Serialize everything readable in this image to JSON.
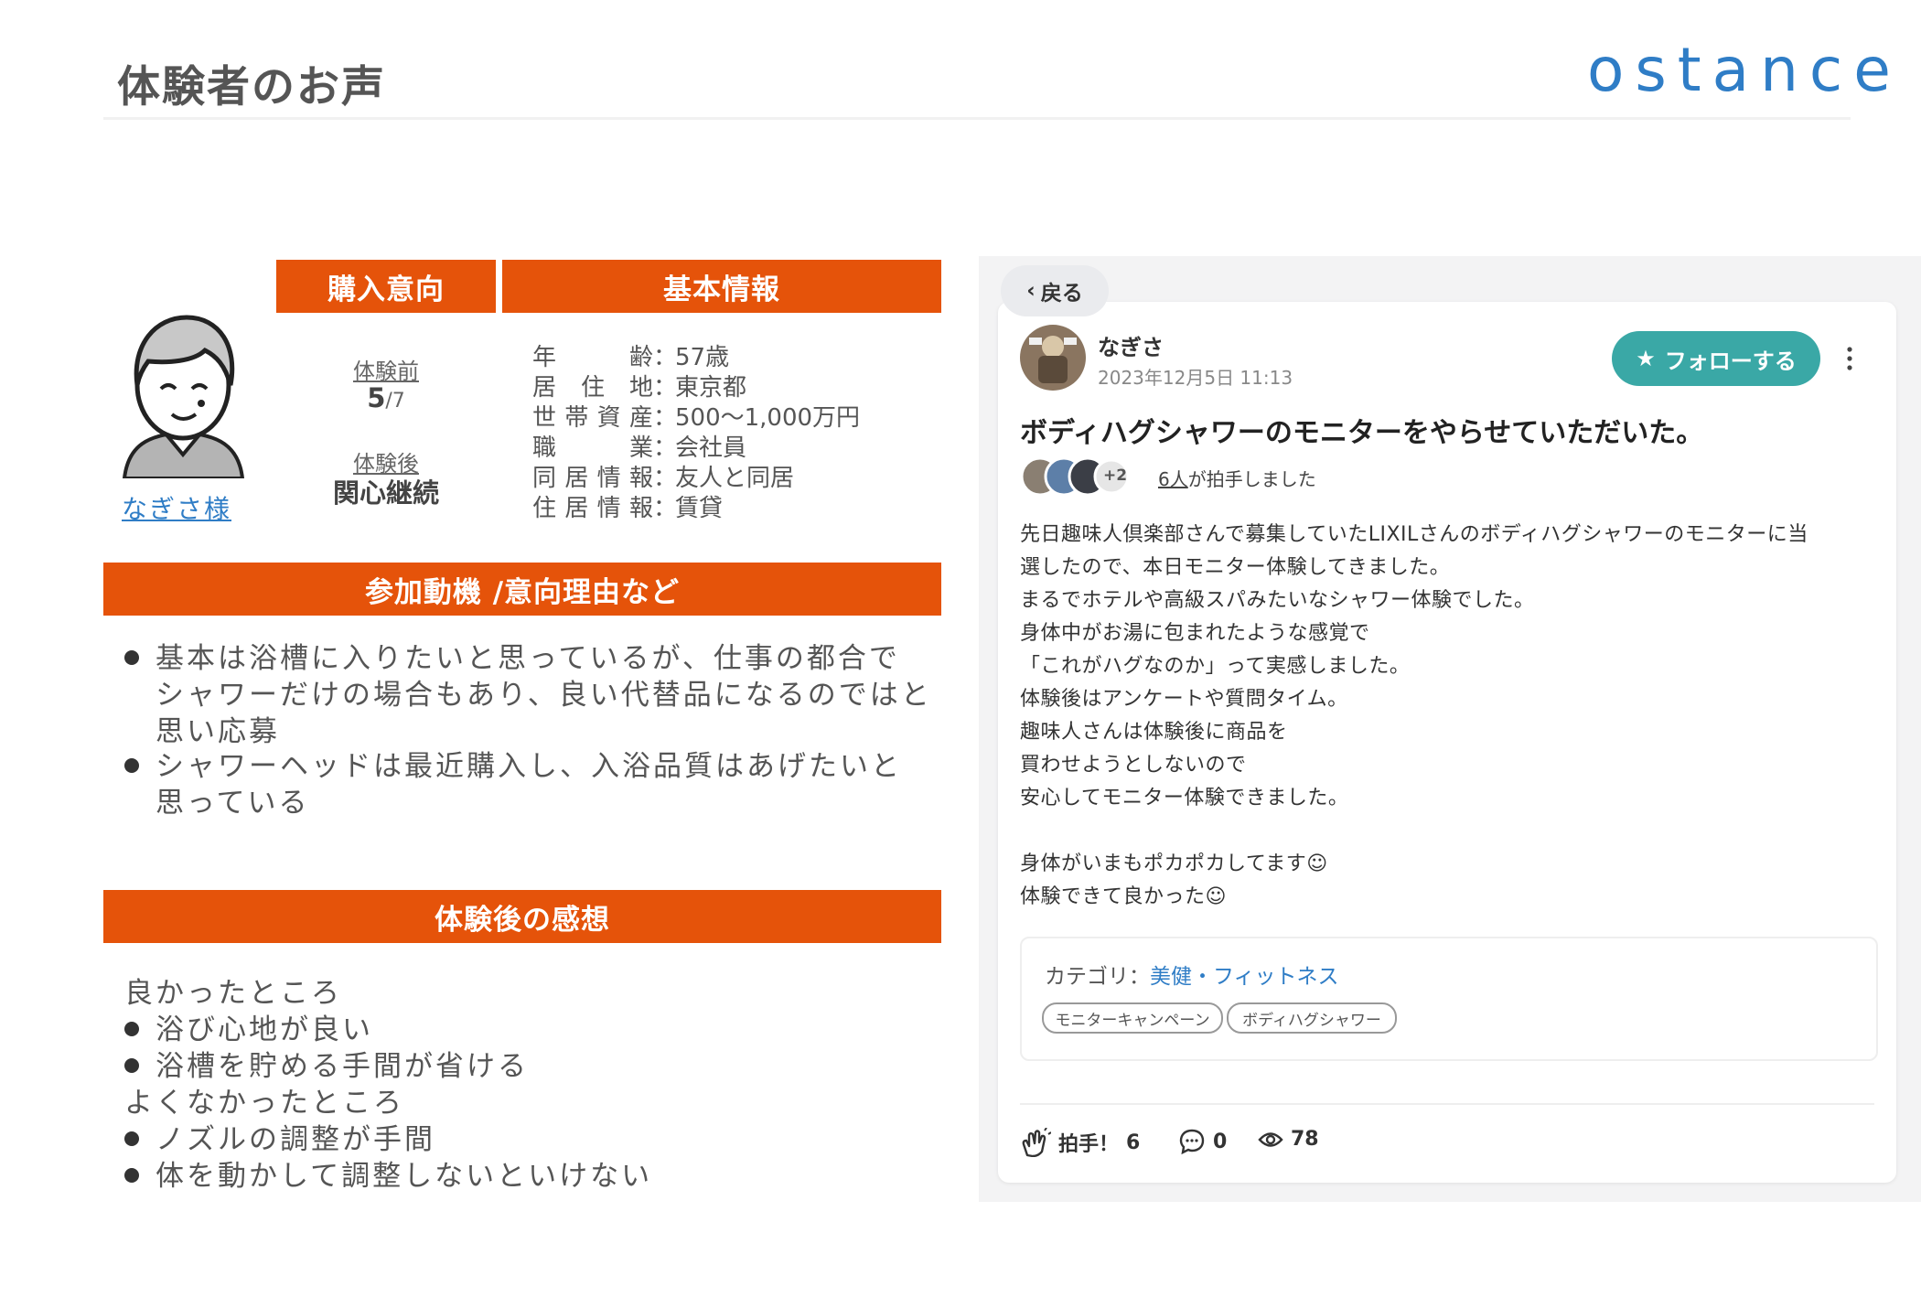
{
  "header": {
    "title": "体験者のお声",
    "brand": "ostance"
  },
  "left": {
    "avatar_name": "なぎさ様",
    "intent": {
      "header": "購入意向",
      "before_label": "体験前",
      "before_value": "5",
      "before_total": "/7",
      "after_label": "体験後",
      "after_value": "関心継続"
    },
    "basic_info": {
      "header": "基本情報",
      "rows": [
        {
          "key": "年齢",
          "value": "57歳"
        },
        {
          "key": "居住地",
          "value": "東京都"
        },
        {
          "key": "世帯資産",
          "value": "500〜1,000万円"
        },
        {
          "key": "職業",
          "value": "会社員"
        },
        {
          "key": "同居情報",
          "value": "友人と同居"
        },
        {
          "key": "住居情報",
          "value": "賃貸"
        }
      ]
    },
    "motive": {
      "header": "参加動機 /意向理由など",
      "bullets": [
        [
          "基本は浴槽に入りたいと思っているが、仕事の都合で",
          "シャワーだけの場合もあり、良い代替品になるのではと",
          "思い応募"
        ],
        [
          "シャワーヘッドは最近購入し、入浴品質はあげたいと",
          "思っている"
        ]
      ]
    },
    "impression": {
      "header": "体験後の感想",
      "good_title": "良かったところ",
      "good": [
        "浴び心地が良い",
        "浴槽を貯める手間が省ける"
      ],
      "bad_title": "よくなかったところ",
      "bad": [
        "ノズルの調整が手間",
        "体を動かして調整しないといけない"
      ]
    }
  },
  "post": {
    "back_label": "戻る",
    "author": "なぎさ",
    "date": "2023年12月5日 11:13",
    "follow_label": "フォローする",
    "title": "ボディハグシャワーのモニターをやらせていただいた。",
    "clap_extra": "+2",
    "clap_people": "6人",
    "clap_suffix": "が拍手しました",
    "body": [
      "先日趣味人倶楽部さんで募集していたLIXILさんのボディハグシャワーのモニターに当",
      "選したので、本日モニター体験してきました。",
      "まるでホテルや高級スパみたいなシャワー体験でした。",
      "身体中がお湯に包まれたような感覚で",
      "「これがハグなのか」って実感しました。",
      "体験後はアンケートや質問タイム。",
      "趣味人さんは体験後に商品を",
      "買わせようとしないので",
      "安心してモニター体験できました。",
      "",
      "身体がいまもポカポカしてます☺",
      "体験できて良かった☺"
    ],
    "category_label": "カテゴリ：",
    "category_value": "美健・フィットネス",
    "tags": [
      "モニターキャンペーン",
      "ボディハグシャワー"
    ],
    "clap_label": "拍手！",
    "clap_count": "6",
    "comment_count": "0",
    "view_count": "78",
    "colors": {
      "accent_orange": "#e5530a",
      "follow_teal": "#3aa8a6",
      "link_blue": "#2f7dc6"
    }
  }
}
